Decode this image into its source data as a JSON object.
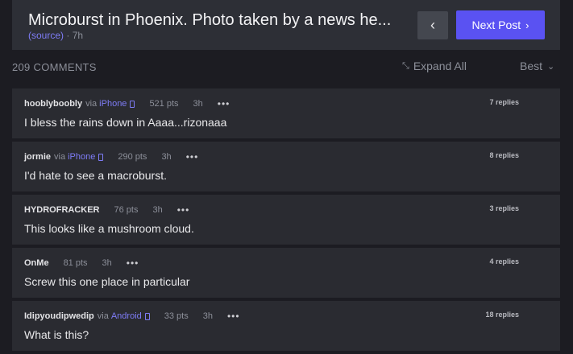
{
  "post": {
    "title": "Microburst in Phoenix. Photo taken by a news he...",
    "source_label": "(source)",
    "age": "· 7h",
    "prev_icon": "‹",
    "next_label": "Next Post",
    "next_icon": "›"
  },
  "toolbar": {
    "comment_count": "209 COMMENTS",
    "expand_all": "Expand All",
    "expand_icon": "⤡",
    "sort": "Best",
    "sort_icon": "⌄"
  },
  "comments": [
    {
      "author": "hooblyboobly",
      "via": "via",
      "device": "iPhone",
      "points": "521 pts",
      "time": "3h",
      "more": "•••",
      "text": "I bless the rains down in Aaaa...rizonaaa",
      "replies": "7 replies"
    },
    {
      "author": "jormie",
      "via": "via",
      "device": "iPhone",
      "points": "290 pts",
      "time": "3h",
      "more": "•••",
      "text": "I'd hate to see a macroburst.",
      "replies": "8 replies"
    },
    {
      "author": "HYDROFRACKER",
      "via": "",
      "device": "",
      "points": "76 pts",
      "time": "3h",
      "more": "•••",
      "text": "This looks like a mushroom cloud.",
      "replies": "3 replies"
    },
    {
      "author": "OnMe",
      "via": "",
      "device": "",
      "points": "81 pts",
      "time": "3h",
      "more": "•••",
      "text": "Screw this one place in particular",
      "replies": "4 replies"
    },
    {
      "author": "Idipyoudipwedip",
      "via": "via",
      "device": "Android",
      "points": "33 pts",
      "time": "3h",
      "more": "•••",
      "text": "What is this?",
      "replies": "18 replies"
    }
  ],
  "colors": {
    "background": "#1c1c22",
    "card": "#2a2b31",
    "accent": "#5a52f2",
    "link": "#7e7cf6"
  }
}
